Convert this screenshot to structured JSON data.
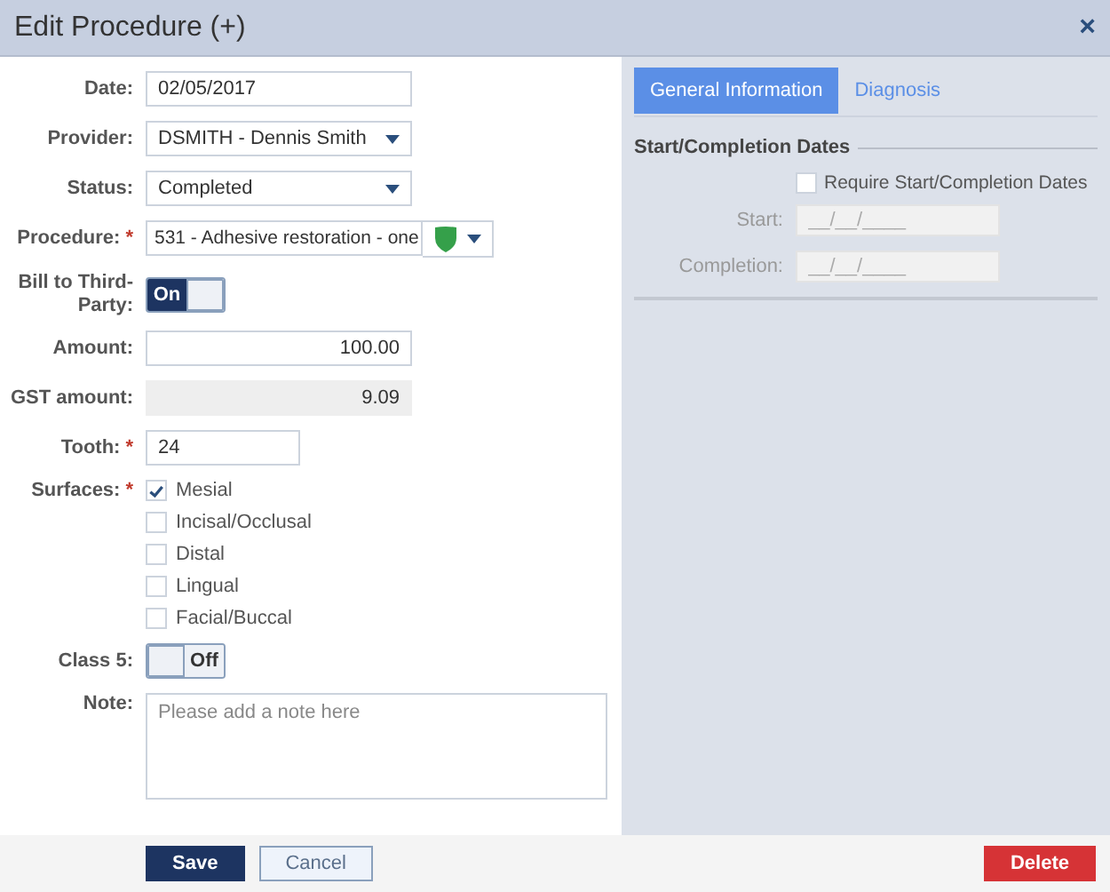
{
  "window": {
    "title": "Edit Procedure (+)",
    "close": "×"
  },
  "form": {
    "fields": [
      {
        "kind": "date",
        "label": "Date:",
        "value": "02/05/2017"
      },
      {
        "kind": "select",
        "label": "Provider:",
        "value": "DSMITH - Dennis Smith"
      },
      {
        "kind": "select",
        "label": "Status:",
        "value": "Completed"
      },
      {
        "kind": "procedure",
        "label": "Procedure:",
        "marker": "*",
        "value": "531 - Adhesive restoration - one"
      },
      {
        "kind": "toggle",
        "label": "Bill to Third-Party:",
        "on": true,
        "text": "On"
      },
      {
        "kind": "money",
        "label": "Amount:",
        "value": "100.00"
      },
      {
        "kind": "readonly",
        "label": "GST amount:",
        "value": "9.09"
      },
      {
        "kind": "number",
        "label": "Tooth:",
        "marker": "*",
        "value": "24"
      },
      {
        "kind": "checkboxes",
        "label": "Surfaces:",
        "marker": "*",
        "options": [
          {
            "label": "Mesial",
            "checked": true
          },
          {
            "label": "Incisal/Occlusal",
            "checked": false
          },
          {
            "label": "Distal",
            "checked": false
          },
          {
            "label": "Lingual",
            "checked": false
          },
          {
            "label": "Facial/Buccal",
            "checked": false
          }
        ]
      },
      {
        "kind": "toggle",
        "label": "Class 5:",
        "on": false,
        "text": "Off"
      },
      {
        "kind": "textarea",
        "label": "Note:",
        "placeholder": "Please add a note here"
      }
    ]
  },
  "details": {
    "tabs": [
      {
        "label": "General Information",
        "selected": true
      },
      {
        "label": "Diagnosis",
        "selected": false
      }
    ],
    "section_title": "Start/Completion Dates",
    "require_dates": {
      "label": "Require Start/Completion Dates",
      "checked": false
    },
    "dates": [
      {
        "label": "Start:",
        "placeholder": "__/__/____",
        "disabled": true
      },
      {
        "label": "Completion:",
        "placeholder": "__/__/____",
        "disabled": true
      }
    ]
  },
  "buttons": [
    {
      "label": "Save",
      "kind": "primary"
    },
    {
      "label": "Cancel",
      "kind": "secondary"
    },
    {
      "label": "Delete",
      "kind": "danger"
    }
  ]
}
